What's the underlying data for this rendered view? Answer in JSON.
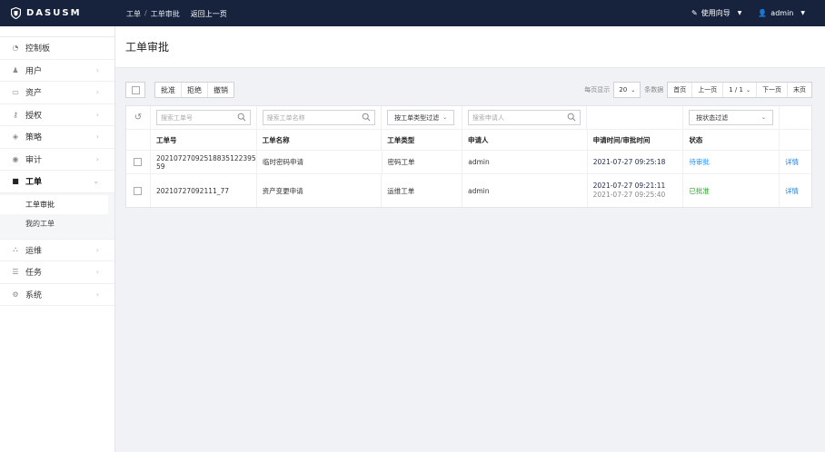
{
  "brand": {
    "name": "DASUSM"
  },
  "breadcrumb": {
    "root": "工单",
    "sep": "/",
    "current": "工单审批",
    "back": "返回上一页"
  },
  "header": {
    "guide": "使用向导",
    "user": "admin"
  },
  "sidebar": {
    "items": [
      {
        "label": "控制板",
        "icon": "dashboard-icon"
      },
      {
        "label": "用户",
        "icon": "user-icon"
      },
      {
        "label": "资产",
        "icon": "monitor-icon"
      },
      {
        "label": "授权",
        "icon": "key-icon"
      },
      {
        "label": "策略",
        "icon": "policy-icon"
      },
      {
        "label": "审计",
        "icon": "eye-icon"
      },
      {
        "label": "工单",
        "icon": "ticket-icon"
      },
      {
        "label": "运维",
        "icon": "ops-icon"
      },
      {
        "label": "任务",
        "icon": "task-icon"
      },
      {
        "label": "系统",
        "icon": "gear-icon"
      }
    ],
    "sub": [
      {
        "label": "工单审批"
      },
      {
        "label": "我的工单"
      }
    ]
  },
  "page": {
    "title": "工单审批"
  },
  "toolbar": {
    "approve": "批准",
    "reject": "拒绝",
    "revoke": "撤销"
  },
  "pager": {
    "per_page_label": "每页显示",
    "per_page": "20",
    "unit": "条数据",
    "first": "首页",
    "prev": "上一页",
    "current": "1 / 1",
    "next": "下一页",
    "last": "末页"
  },
  "filters": {
    "ticket_no_ph": "搜索工单号",
    "ticket_name_ph": "搜索工单名称",
    "type_filter": "按工单类型过滤",
    "applicant_ph": "搜索申请人",
    "status_filter": "按状态过滤"
  },
  "columns": [
    "工单号",
    "工单名称",
    "工单类型",
    "申请人",
    "申请时间/审批时间",
    "状态"
  ],
  "rows": [
    {
      "no": "20210727092518835122395​59",
      "name": "临时密码申请",
      "type": "密码工单",
      "applicant": "admin",
      "time1": "2021-07-27 09:25:18",
      "time2": "",
      "status": "待审批",
      "action": "详情"
    },
    {
      "no": "20210727092111_77",
      "name": "资产变更申请",
      "type": "运维工单",
      "applicant": "admin",
      "time1": "2021-07-27 09:21:11",
      "time2": "2021-07-27 09:25:40",
      "status": "已批准",
      "action": "详情"
    }
  ],
  "colors": {
    "topbar": "#17233c",
    "pending": "#1e90ff",
    "approved": "#2aa52a",
    "link": "#1e7fd8"
  }
}
